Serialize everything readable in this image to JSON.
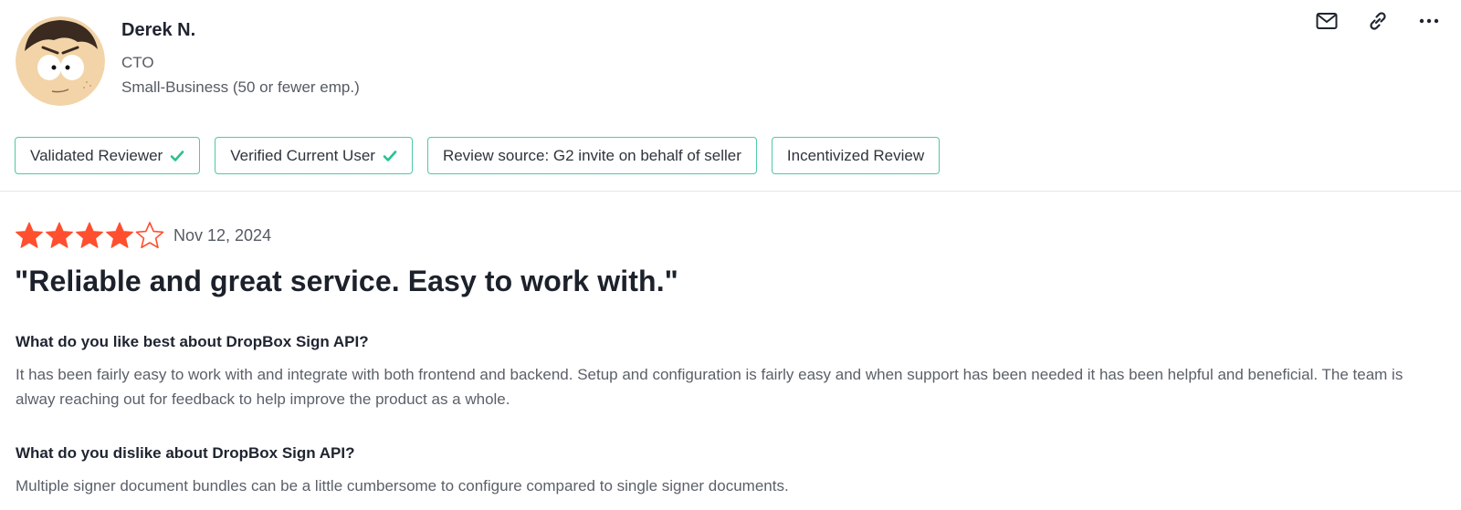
{
  "reviewer": {
    "name": "Derek N.",
    "title": "CTO",
    "segment": "Small-Business (50 or fewer emp.)"
  },
  "actions": {
    "icons": [
      "mail-icon",
      "link-icon",
      "more-icon"
    ],
    "more_label": "..."
  },
  "badges": [
    {
      "label": "Validated Reviewer",
      "checked": true
    },
    {
      "label": "Verified Current User",
      "checked": true
    },
    {
      "label": "Review source: G2 invite on behalf of seller",
      "checked": false
    },
    {
      "label": "Incentivized Review",
      "checked": false
    }
  ],
  "review": {
    "rating": 4,
    "rating_max": 5,
    "date": "Nov 12, 2024",
    "title": "\"Reliable and great service. Easy to work with.\"",
    "sections": [
      {
        "question": "What do you like best about DropBox Sign API?",
        "answer": "It has been fairly easy to work with and integrate with both frontend and backend. Setup and configuration is fairly easy and when support has been needed it has been helpful and beneficial. The team is alway reaching out for feedback to help improve the product as a whole."
      },
      {
        "question": "What do you dislike about DropBox Sign API?",
        "answer": "Multiple signer document bundles can be a little cumbersome to configure compared to single signer documents."
      }
    ]
  },
  "colors": {
    "star": "#ff4f2e",
    "badge_border": "#4fc9a6",
    "check": "#27c190"
  }
}
